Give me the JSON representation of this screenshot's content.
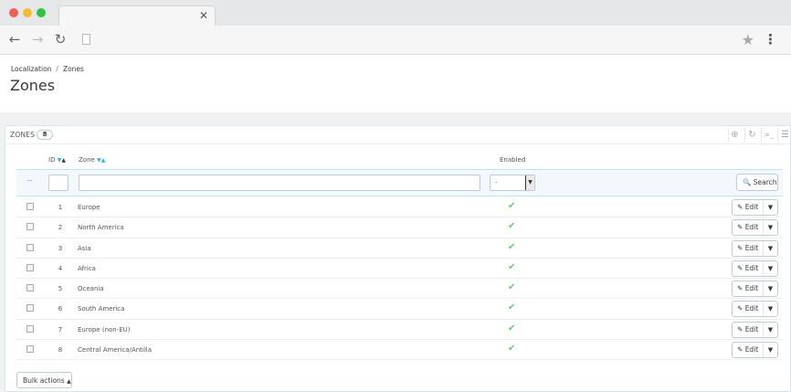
{
  "browser": {
    "tab_close": "✕",
    "window_controls": [
      "close",
      "minimize",
      "maximize"
    ]
  },
  "breadcrumb": {
    "parent": "Localization",
    "separator": "/",
    "current": "Zones"
  },
  "page_title": "Zones",
  "panel": {
    "title": "Zones",
    "count": "8",
    "toolbar_icons": [
      "add-icon",
      "refresh-icon",
      "sql-terminal-icon",
      "database-icon"
    ]
  },
  "table": {
    "columns": {
      "id": "ID",
      "zone": "Zone",
      "enabled": "Enabled"
    },
    "filter": {
      "enabled_select": "-",
      "search_label": "Search",
      "dash": "--"
    },
    "rows": [
      {
        "id": "1",
        "zone": "Europe",
        "enabled": true
      },
      {
        "id": "2",
        "zone": "North America",
        "enabled": true
      },
      {
        "id": "3",
        "zone": "Asia",
        "enabled": true
      },
      {
        "id": "4",
        "zone": "Africa",
        "enabled": true
      },
      {
        "id": "5",
        "zone": "Oceania",
        "enabled": true
      },
      {
        "id": "6",
        "zone": "South America",
        "enabled": true
      },
      {
        "id": "7",
        "zone": "Europe (non-EU)",
        "enabled": true
      },
      {
        "id": "8",
        "zone": "Central America/Antilla",
        "enabled": true
      }
    ],
    "edit_label": "Edit"
  },
  "bulk_actions_label": "Bulk actions",
  "colors": {
    "accent": "#25b9d7",
    "enabled_check": "#72c279",
    "filter_bg": "#f2f8fb"
  }
}
